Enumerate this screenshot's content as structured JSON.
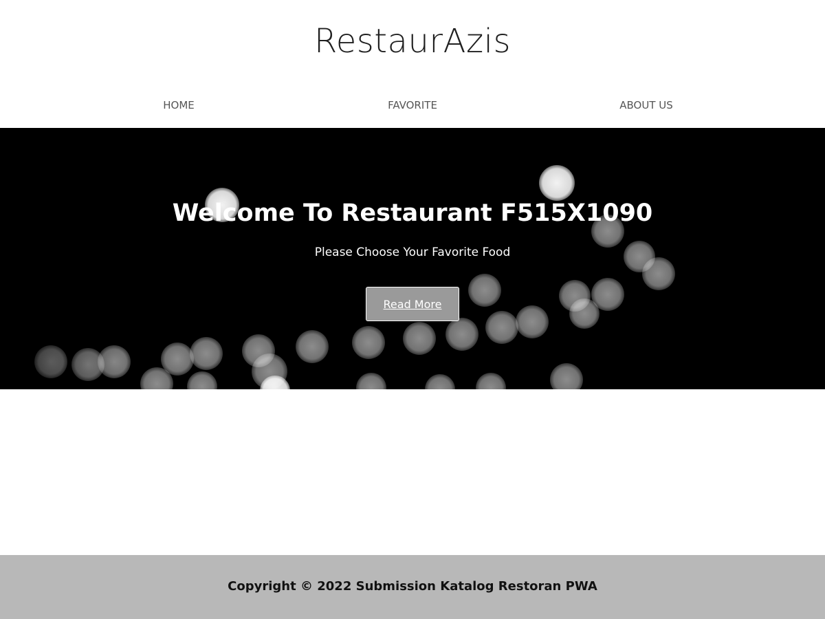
{
  "header": {
    "brand": "RestaurAzis",
    "nav": [
      {
        "label": "HOME"
      },
      {
        "label": "FAVORITE"
      },
      {
        "label": "ABOUT US"
      }
    ]
  },
  "hero": {
    "title": "Welcome To Restaurant F515X1090",
    "subtitle": "Please Choose Your Favorite Food",
    "button_label": "Read More"
  },
  "footer": {
    "copyright": "Copyright © 2022 Submission Katalog Restoran PWA"
  },
  "colors": {
    "hero_background": "#000000",
    "footer_background": "#b8b8b8",
    "button_background": "#9a9a9a",
    "brand_text": "#1f1f1f",
    "nav_text": "#555555"
  }
}
